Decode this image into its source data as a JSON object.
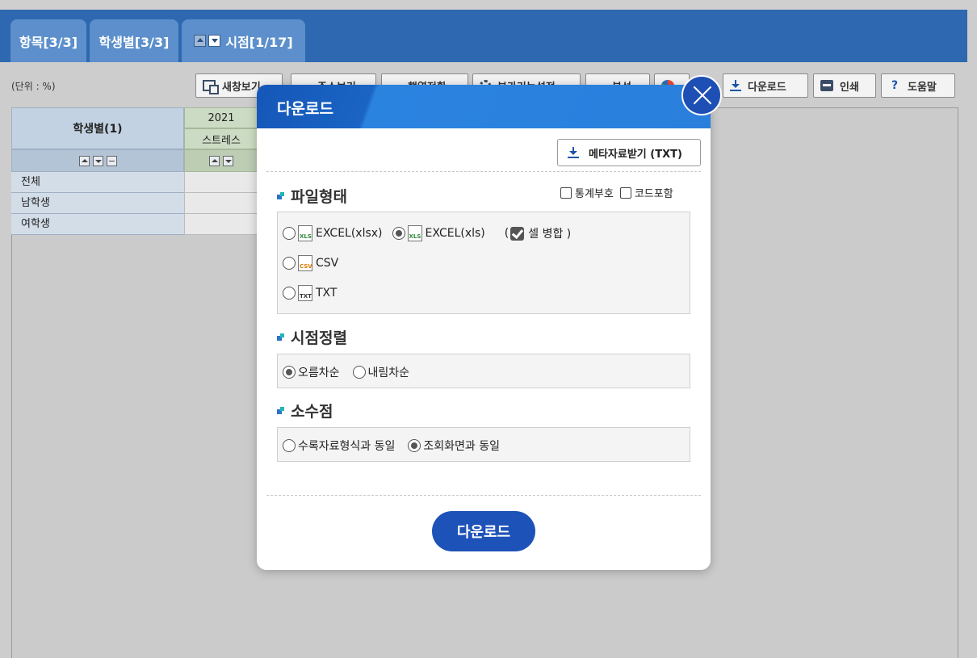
{
  "tabs": {
    "items": "항목[3/3]",
    "students": "학생별[3/3]",
    "periods": "시점[1/17]"
  },
  "unit_label": "(단위 : %)",
  "toolbar": {
    "new_window": "새창보기",
    "addr": "주소보기",
    "pivot": "행열전환",
    "extra": "부가기능설정",
    "analysis": "분석",
    "download": "다운로드",
    "print": "인쇄",
    "help": "도움말"
  },
  "grid": {
    "header_label": "학생별(1)",
    "year": "2021",
    "column": "스트레스",
    "rows": [
      "전체",
      "남학생",
      "여학생"
    ]
  },
  "modal": {
    "title": "다운로드",
    "meta_button": "메타자료받기 (TXT)",
    "file_type": {
      "title": "파일형태",
      "stat_symbol": "통계부호",
      "code_include": "코드포함",
      "xlsx": "EXCEL(xlsx)",
      "xls": "EXCEL(xls)",
      "merge_prefix": "(",
      "merge": "셀 병합 )",
      "csv": "CSV",
      "txt": "TXT",
      "selected": "xls"
    },
    "sort": {
      "title": "시점정렬",
      "asc": "오름차순",
      "desc": "내림차순",
      "selected": "asc"
    },
    "decimal": {
      "title": "소수점",
      "same_as_source": "수록자료형식과 동일",
      "same_as_view": "조회화면과 동일",
      "selected": "same_as_view"
    },
    "download_button": "다운로드"
  },
  "icons": {
    "file_xls": "XLS",
    "file_csv": "CSV",
    "file_txt": "TXT",
    "help_glyph": "?"
  },
  "colors": {
    "accent_blue": "#1d52b8",
    "tab_bar": "#2e68b0"
  }
}
